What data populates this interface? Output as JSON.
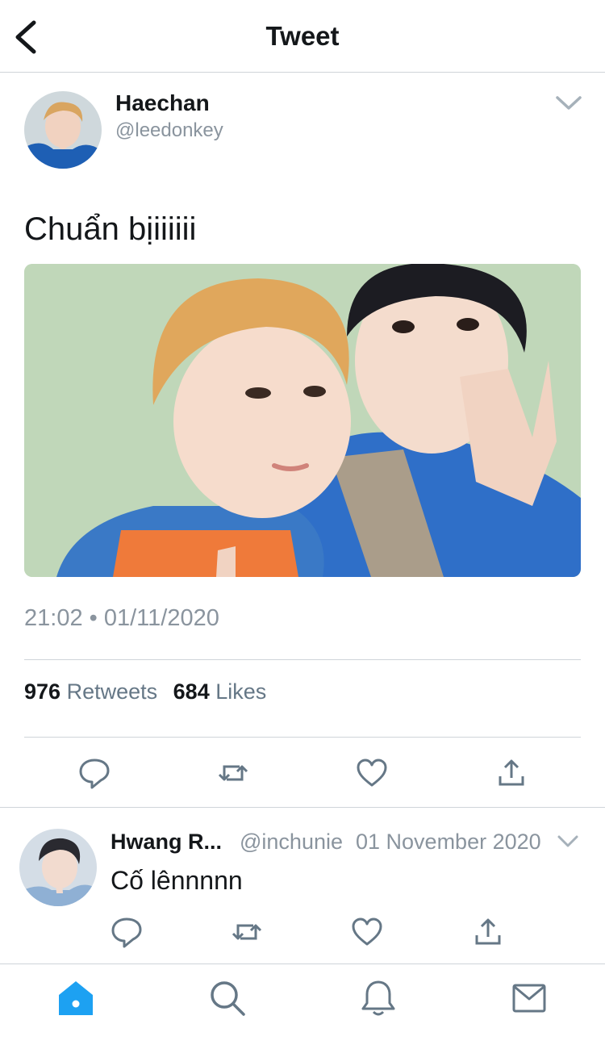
{
  "header": {
    "title": "Tweet",
    "back_icon": "chevron-left-icon"
  },
  "tweet": {
    "author_name": "Haechan",
    "author_handle": "@leedonkey",
    "text": "Chuẩn bịiiiiii",
    "time": "21:02 • 01/11/2020",
    "retweets_count": "976",
    "retweets_label": "Retweets",
    "likes_count": "684",
    "likes_label": "Likes",
    "actions": [
      "reply-icon",
      "retweet-icon",
      "like-icon",
      "share-icon"
    ]
  },
  "reply": {
    "author_name": "Hwang R...",
    "author_handle": "@inchunie",
    "date": "01 November 2020",
    "text": "Cố lênnnnn"
  },
  "tabbar": {
    "items": [
      "home-icon",
      "search-icon",
      "notifications-icon",
      "messages-icon"
    ],
    "active": "home-icon"
  },
  "colors": {
    "accent": "#1da1f2",
    "icon": "#657786",
    "muted": "#8a949e",
    "divider": "#cfd4d9"
  }
}
